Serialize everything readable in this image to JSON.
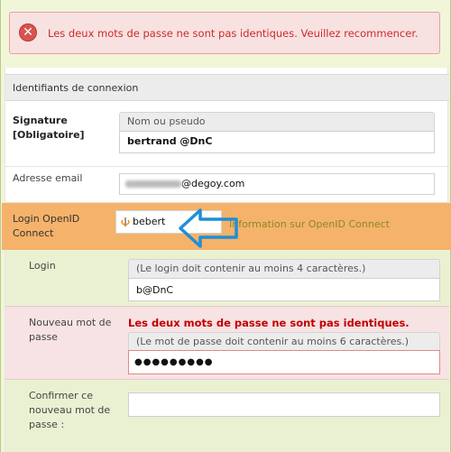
{
  "alert": {
    "message": "Les deux mots de passe ne sont pas identiques. Veuillez recommencer.",
    "icon": "error-circle-x-icon"
  },
  "section": {
    "title": "Identifiants de connexion"
  },
  "signature": {
    "label_line1": "Signature",
    "label_line2": "[Obligatoire]",
    "placeholder": "Nom ou pseudo",
    "value": "bertrand @DnC"
  },
  "email": {
    "label": "Adresse email",
    "value": "@degoy.com"
  },
  "openid": {
    "label_line1": "Login OpenID",
    "label_line2": "Connect",
    "value": "bebert",
    "info_link": "Information sur OpenID Connect"
  },
  "login": {
    "label": "Login",
    "hint": "(Le login doit contenir au moins 4 caractères.)",
    "value": "b@DnC"
  },
  "new_password": {
    "label_line1": "Nouveau mot de",
    "label_line2": "passe",
    "error": "Les deux mots de passe ne sont pas identiques.",
    "hint": "(Le mot de passe doit contenir au moins 6 caractères.)",
    "value": "●●●●●●●●●"
  },
  "confirm_password": {
    "label_line1": "Confirmer ce",
    "label_line2": "nouveau mot de",
    "label_line3": "passe :",
    "value": ""
  },
  "colors": {
    "background": "#f1f6d8",
    "alert_bg": "#f8e1e1",
    "alert_text": "#cc2b2b",
    "openid_highlight": "#f5b26a",
    "arrow": "#1f8fd6",
    "error_bg": "#f7e2e4",
    "sub_bg": "#eaf1d2"
  }
}
